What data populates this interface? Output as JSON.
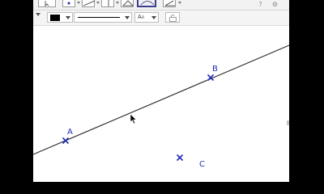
{
  "toolbar": {
    "tools": [
      {
        "name": "move-tool-icon"
      },
      {
        "name": "point-tool-icon"
      },
      {
        "name": "line-tool-icon"
      },
      {
        "name": "perpendicular-tool-icon"
      },
      {
        "name": "polygon-tool-icon"
      },
      {
        "name": "circle-tool-icon"
      },
      {
        "name": "angle-tool-icon"
      },
      {
        "name": "reflect-tool-icon"
      }
    ],
    "right_icons": {
      "help": "?",
      "settings": "⚙"
    }
  },
  "style_bar": {
    "color": "#000000",
    "label_style_text": "A",
    "label_style_small": "A"
  },
  "graphics": {
    "points": [
      {
        "label": "A",
        "color": "#1f2cb5"
      },
      {
        "label": "B",
        "color": "#1f2cb5"
      },
      {
        "label": "C",
        "color": "#1f2cb5"
      }
    ],
    "line_through": [
      "A",
      "B"
    ],
    "line_color": "#333333"
  }
}
